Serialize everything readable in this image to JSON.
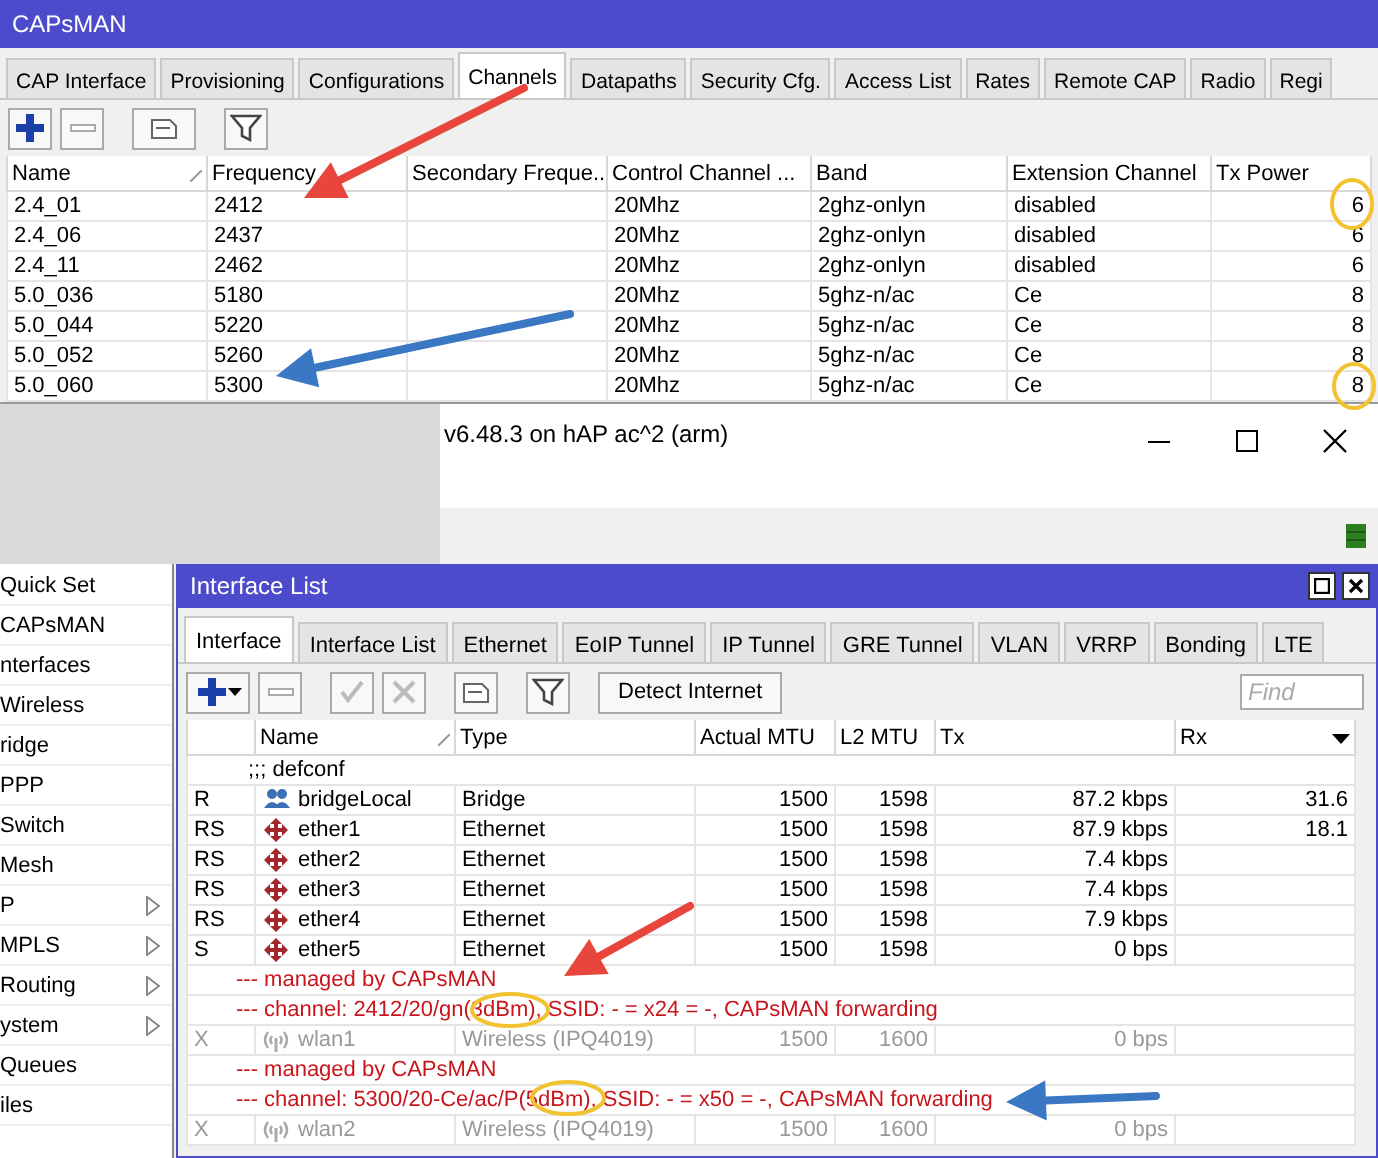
{
  "capsman_window": {
    "title": "CAPsMAN",
    "tabs": [
      {
        "label": "CAP Interface",
        "selected": false
      },
      {
        "label": "Provisioning",
        "selected": false
      },
      {
        "label": "Configurations",
        "selected": false
      },
      {
        "label": "Channels",
        "selected": true
      },
      {
        "label": "Datapaths",
        "selected": false
      },
      {
        "label": "Security Cfg.",
        "selected": false
      },
      {
        "label": "Access List",
        "selected": false
      },
      {
        "label": "Rates",
        "selected": false
      },
      {
        "label": "Remote CAP",
        "selected": false
      },
      {
        "label": "Radio",
        "selected": false
      },
      {
        "label": "Regi",
        "selected": false
      }
    ],
    "columns": [
      "Name",
      "Frequency",
      "Secondary Freque...",
      "Control Channel ...",
      "Band",
      "Extension Channel",
      "Tx Power"
    ],
    "rows": [
      [
        "2.4_01",
        "2412",
        "",
        "20Mhz",
        "2ghz-onlyn",
        "disabled",
        "6"
      ],
      [
        "2.4_06",
        "2437",
        "",
        "20Mhz",
        "2ghz-onlyn",
        "disabled",
        "6"
      ],
      [
        "2.4_11",
        "2462",
        "",
        "20Mhz",
        "2ghz-onlyn",
        "disabled",
        "6"
      ],
      [
        "5.0_036",
        "5180",
        "",
        "20Mhz",
        "5ghz-n/ac",
        "Ce",
        "8"
      ],
      [
        "5.0_044",
        "5220",
        "",
        "20Mhz",
        "5ghz-n/ac",
        "Ce",
        "8"
      ],
      [
        "5.0_052",
        "5260",
        "",
        "20Mhz",
        "5ghz-n/ac",
        "Ce",
        "8"
      ],
      [
        "5.0_060",
        "5300",
        "",
        "20Mhz",
        "5ghz-n/ac",
        "Ce",
        "8"
      ]
    ]
  },
  "main_window": {
    "title": "v6.48.3 on hAP ac^2 (arm)",
    "sidebar": {
      "items": [
        {
          "label": "Quick Set",
          "submenu": false
        },
        {
          "label": "CAPsMAN",
          "submenu": false
        },
        {
          "label": "nterfaces",
          "submenu": false
        },
        {
          "label": "Wireless",
          "submenu": false
        },
        {
          "label": "ridge",
          "submenu": false
        },
        {
          "label": "PPP",
          "submenu": false
        },
        {
          "label": "Switch",
          "submenu": false
        },
        {
          "label": "Mesh",
          "submenu": false
        },
        {
          "label": "P",
          "submenu": true
        },
        {
          "label": "MPLS",
          "submenu": true
        },
        {
          "label": "Routing",
          "submenu": true
        },
        {
          "label": "ystem",
          "submenu": true
        },
        {
          "label": "Queues",
          "submenu": false
        },
        {
          "label": "iles",
          "submenu": false
        }
      ]
    }
  },
  "interface_window": {
    "title": "Interface List",
    "tabs": [
      {
        "label": "Interface",
        "selected": true
      },
      {
        "label": "Interface List",
        "selected": false
      },
      {
        "label": "Ethernet",
        "selected": false
      },
      {
        "label": "EoIP Tunnel",
        "selected": false
      },
      {
        "label": "IP Tunnel",
        "selected": false
      },
      {
        "label": "GRE Tunnel",
        "selected": false
      },
      {
        "label": "VLAN",
        "selected": false
      },
      {
        "label": "VRRP",
        "selected": false
      },
      {
        "label": "Bonding",
        "selected": false
      },
      {
        "label": "LTE",
        "selected": false
      }
    ],
    "detect_button": "Detect Internet",
    "find_placeholder": "Find",
    "columns": [
      "",
      "Name",
      "Type",
      "Actual MTU",
      "L2 MTU",
      "Tx",
      "Rx"
    ],
    "rows": [
      {
        "kind": "comment",
        "text": ";;; defconf"
      },
      {
        "kind": "bridge",
        "flags": "R",
        "name": "bridgeLocal",
        "type": "Bridge",
        "actual_mtu": "1500",
        "l2_mtu": "1598",
        "tx": "87.2 kbps",
        "rx": "31.6",
        "disabled": false
      },
      {
        "kind": "ethernet",
        "flags": "RS",
        "name": "ether1",
        "type": "Ethernet",
        "actual_mtu": "1500",
        "l2_mtu": "1598",
        "tx": "87.9 kbps",
        "rx": "18.1",
        "disabled": false
      },
      {
        "kind": "ethernet",
        "flags": "RS",
        "name": "ether2",
        "type": "Ethernet",
        "actual_mtu": "1500",
        "l2_mtu": "1598",
        "tx": "7.4 kbps",
        "rx": "",
        "disabled": false
      },
      {
        "kind": "ethernet",
        "flags": "RS",
        "name": "ether3",
        "type": "Ethernet",
        "actual_mtu": "1500",
        "l2_mtu": "1598",
        "tx": "7.4 kbps",
        "rx": "",
        "disabled": false
      },
      {
        "kind": "ethernet",
        "flags": "RS",
        "name": "ether4",
        "type": "Ethernet",
        "actual_mtu": "1500",
        "l2_mtu": "1598",
        "tx": "7.9 kbps",
        "rx": "",
        "disabled": false
      },
      {
        "kind": "ethernet",
        "flags": "S",
        "name": "ether5",
        "type": "Ethernet",
        "actual_mtu": "1500",
        "l2_mtu": "1598",
        "tx": "0 bps",
        "rx": "",
        "disabled": false
      },
      {
        "kind": "note",
        "text": "--- managed by CAPsMAN"
      },
      {
        "kind": "note",
        "text": "--- channel: 2412/20/gn(3dBm), SSID: - = x24 = -, CAPsMAN forwarding"
      },
      {
        "kind": "wireless",
        "flags": "X",
        "name": "wlan1",
        "type": "Wireless (IPQ4019)",
        "actual_mtu": "1500",
        "l2_mtu": "1600",
        "tx": "0 bps",
        "rx": "",
        "disabled": true
      },
      {
        "kind": "note",
        "text": "--- managed by CAPsMAN"
      },
      {
        "kind": "note",
        "text": "--- channel: 5300/20-Ce/ac/P(5dBm), SSID: - = x50 = -, CAPsMAN forwarding"
      },
      {
        "kind": "wireless",
        "flags": "X",
        "name": "wlan2",
        "type": "Wireless (IPQ4019)",
        "actual_mtu": "1500",
        "l2_mtu": "1600",
        "tx": "0 bps",
        "rx": "",
        "disabled": true
      }
    ]
  },
  "annotations": [
    {
      "kind": "arrow",
      "color": "#e8453c"
    },
    {
      "kind": "arrow",
      "color": "#3b78c4"
    },
    {
      "kind": "arrow",
      "color": "#e8453c"
    },
    {
      "kind": "arrow",
      "color": "#3b78c4"
    },
    {
      "kind": "ellipse",
      "color": "#f2c230"
    },
    {
      "kind": "ellipse",
      "color": "#f2c230"
    },
    {
      "kind": "ellipse",
      "color": "#f2c230"
    },
    {
      "kind": "ellipse",
      "color": "#f2c230"
    }
  ]
}
